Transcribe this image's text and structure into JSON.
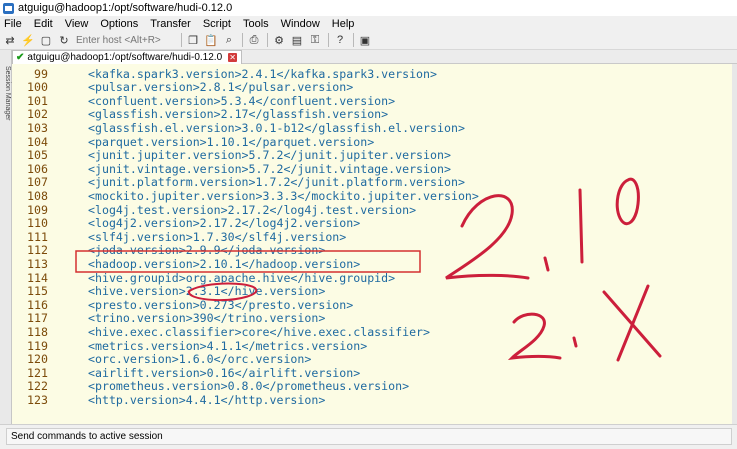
{
  "window": {
    "title": "atguigu@hadoop1:/opt/software/hudi-0.12.0"
  },
  "menu": [
    "File",
    "Edit",
    "View",
    "Options",
    "Transfer",
    "Script",
    "Tools",
    "Window",
    "Help"
  ],
  "toolbar": {
    "host_placeholder": "Enter host <Alt+R>"
  },
  "tab": {
    "label": "atguigu@hadoop1:/opt/software/hudi-0.12.0"
  },
  "side_panel": {
    "tabs": [
      "Session Manager"
    ]
  },
  "editor": {
    "lines": [
      {
        "num": "99",
        "text": "<kafka.spark3.version>2.4.1</kafka.spark3.version>"
      },
      {
        "num": "100",
        "text": "<pulsar.version>2.8.1</pulsar.version>"
      },
      {
        "num": "101",
        "text": "<confluent.version>5.3.4</confluent.version>"
      },
      {
        "num": "102",
        "text": "<glassfish.version>2.17</glassfish.version>"
      },
      {
        "num": "103",
        "text": "<glassfish.el.version>3.0.1-b12</glassfish.el.version>"
      },
      {
        "num": "104",
        "text": "<parquet.version>1.10.1</parquet.version>"
      },
      {
        "num": "105",
        "text": "<junit.jupiter.version>5.7.2</junit.jupiter.version>"
      },
      {
        "num": "106",
        "text": "<junit.vintage.version>5.7.2</junit.vintage.version>"
      },
      {
        "num": "107",
        "text": "<junit.platform.version>1.7.2</junit.platform.version>"
      },
      {
        "num": "108",
        "text": "<mockito.jupiter.version>3.3.3</mockito.jupiter.version>"
      },
      {
        "num": "109",
        "text": "<log4j.test.version>2.17.2</log4j.test.version>"
      },
      {
        "num": "110",
        "text": "<log4j2.version>2.17.2</log4j2.version>"
      },
      {
        "num": "111",
        "text": "<slf4j.version>1.7.30</slf4j.version>"
      },
      {
        "num": "112",
        "text": "<joda.version>2.9.9</joda.version>"
      },
      {
        "num": "113",
        "text": "<hadoop.version>2.10.1</hadoop.version>"
      },
      {
        "num": "114",
        "text": "<hive.groupid>org.apache.hive</hive.groupid>"
      },
      {
        "num": "115",
        "text": "<hive.version>2.3.1</hive.version>"
      },
      {
        "num": "116",
        "text": "<presto.version>0.273</presto.version>"
      },
      {
        "num": "117",
        "text": "<trino.version>390</trino.version>"
      },
      {
        "num": "118",
        "text": "<hive.exec.classifier>core</hive.exec.classifier>"
      },
      {
        "num": "119",
        "text": "<metrics.version>4.1.1</metrics.version>"
      },
      {
        "num": "120",
        "text": "<orc.version>1.6.0</orc.version>"
      },
      {
        "num": "121",
        "text": "<airlift.version>0.16</airlift.version>"
      },
      {
        "num": "122",
        "text": "<prometheus.version>0.8.0</prometheus.version>"
      },
      {
        "num": "123",
        "text": "<http.version>4.4.1</http.version>"
      }
    ]
  },
  "status": {
    "send_commands": "Send commands to active session"
  },
  "colors": {
    "terminal_bg": "#fcfce4",
    "code_text": "#1f6aa0",
    "line_number": "#7c4b0a",
    "annotation_box": "#d43030",
    "handwriting": "#cc1f3b"
  }
}
